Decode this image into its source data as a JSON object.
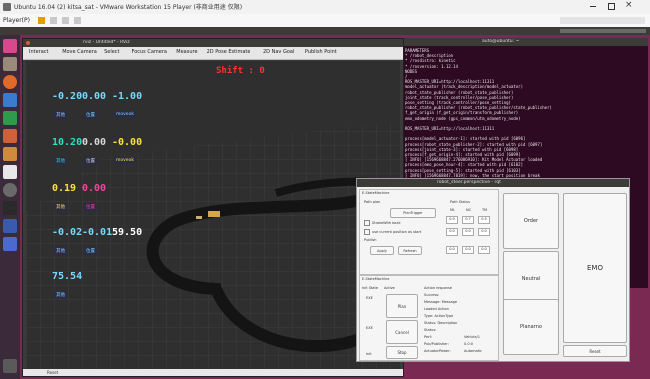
{
  "vmware": {
    "title": "Ubuntu 16.04 (2) kitsa_sat - VMware Workstation 15 Player (非商业用途 仅限)",
    "menu_label": "Player(P)"
  },
  "rviz": {
    "window_title": "rviz - Untitled* - RViz",
    "toolbar": [
      "Interact",
      "Move Camera",
      "Select",
      "Focus Camera",
      "Measure",
      "2D Pose Estimate",
      "2D Nav Goal",
      "Publish Point"
    ],
    "overlay": {
      "shift_text": "Shift : 0",
      "row1": {
        "values": [
          "-0.20",
          "0.00",
          "-1.00"
        ],
        "labels": [
          "其他",
          "位置",
          "moveok"
        ]
      },
      "row2": {
        "values": [
          "10.20",
          "0.00",
          "-0.00"
        ],
        "labels": [
          "其他",
          "位置",
          "moveok"
        ]
      },
      "row3": {
        "values": [
          "0.19",
          "0.00"
        ],
        "labels": [
          "其他",
          "位置"
        ]
      },
      "row4": {
        "values": [
          "-0.02",
          "-0.01",
          "59.50"
        ],
        "labels": [
          "其他",
          "位置"
        ]
      },
      "row5": {
        "values": [
          "75.54"
        ],
        "labels": [
          "其他"
        ]
      }
    },
    "status": "Reset"
  },
  "terminal": {
    "title": "auto@ubuntu: ~",
    "lines": [
      "PARAMETERS",
      " * /robot_description",
      " * /rosdistro: kinetic",
      " * /rosversion: 1.12.14",
      "NODES",
      "  /",
      "    ROS_MASTER_URI=http://localhost:11311",
      "    model_actuator (track_description/model_actuator)",
      "    robot_state_publisher (robot_state_publisher)",
      "    joint_state (track_controller/pose_publisher)",
      "    pose_setting (track_controller/pose_setting)",
      "    robot_state_publisher (robot_state_publisher/state_publisher)",
      "    f_get_origin (f_get_origin/transform_publisher)",
      "    emo_odometry_node (gps_common/utm_odometry_node)",
      "",
      "ROS_MASTER_URI=http://localhost:11311",
      "",
      "process[model_actuator-1]: started with pid [6096]",
      "process[robot_state_publisher-2]: started with pid [6097]",
      "process[joint_state-3]: started with pid [6098]",
      "process[f_get_origin-4]: started with pid [6099]",
      "[ INFO] [1569668847.276006910]: Kit Model Actuator loaded",
      "process[emo_pose_hour-4]: started with pid [6102]",
      "process[pose_setting-5]: started with pid [6103]",
      "[ INFO] [1569668847.7819]: now, the start position break",
      "|"
    ]
  },
  "rqt": {
    "title": "robot_steer.perspective - rqt",
    "top_panel_title": "E-StateMachine",
    "left_group": "Path plan",
    "plan_trigger": "PlanTrigger",
    "checks": [
      "StrokeWith back",
      "use current position as start"
    ],
    "publish_label": "Publish",
    "small_btns": [
      "Apply",
      "Refresh"
    ],
    "mid_group": "Path Status",
    "mid_cols": [
      "ML",
      "NC",
      "TM"
    ],
    "mid_vals": [
      [
        "0.9",
        "0.7",
        "0.5"
      ],
      [
        "0.0",
        "0.0",
        "0.0"
      ],
      [
        "0.0",
        "0.0",
        "0.0"
      ]
    ],
    "order_btn": "Order",
    "neutral_btn": "Neutral",
    "moment_btn": "Planarno",
    "emo_btn": "EMO",
    "reset_btn": "Reset",
    "lower_panel_title": "E-StateMachine",
    "lower_left": [
      "Init State",
      "Active"
    ],
    "lower_btns": [
      "Plan",
      "Cancel",
      "Stop"
    ],
    "side_labels": [
      "EXE",
      "EXE",
      "Init"
    ],
    "response_lines": [
      "Action response",
      "Success:",
      "Message: Message",
      "Loaded Action",
      "Type: ActionType",
      "Status: Description",
      "Status:",
      "Perf:",
      "Pub/Publisher:",
      "ActuatorPower:"
    ],
    "response_values": [
      "",
      "",
      "",
      "",
      "",
      "",
      "",
      "Vehicle/1",
      "0.0:0",
      "Automatic"
    ]
  }
}
